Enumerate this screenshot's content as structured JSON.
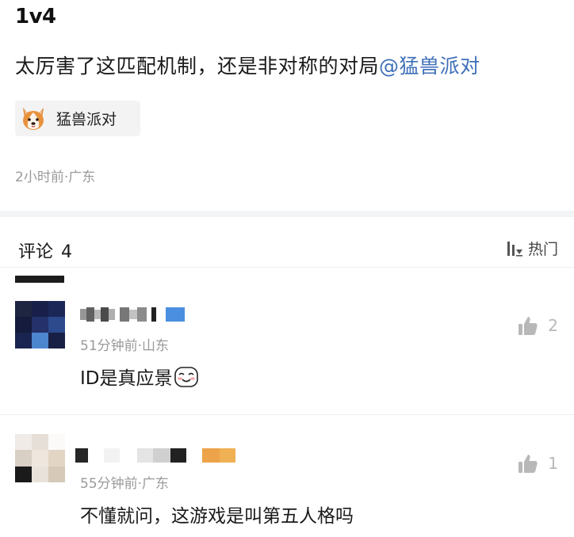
{
  "post": {
    "title": "1v4",
    "body_text": "太厉害了这匹配机制，还是非对称的对局",
    "mention": "@猛兽派对",
    "topic_chip": {
      "label": "猛兽派对",
      "icon": "corgi-dog-icon"
    },
    "meta": "2小时前·广东"
  },
  "comments_section": {
    "label": "评论",
    "count": "4",
    "sort_label": "热门",
    "sort_icon": "sort-bars-icon"
  },
  "comments": [
    {
      "time_location": "51分钟前·山东",
      "text": "ID是真应景",
      "emoji": "blushing-smile-emoji",
      "like_count": "2"
    },
    {
      "time_location": "55分钟前·广东",
      "text": "不懂就问，这游戏是叫第五人格吗",
      "like_count": "1"
    }
  ],
  "colors": {
    "mention": "#3e6fb8",
    "meta_gray": "#9a9a9a",
    "band": "#f3f4f6",
    "like_gray": "#b8b8b8"
  }
}
